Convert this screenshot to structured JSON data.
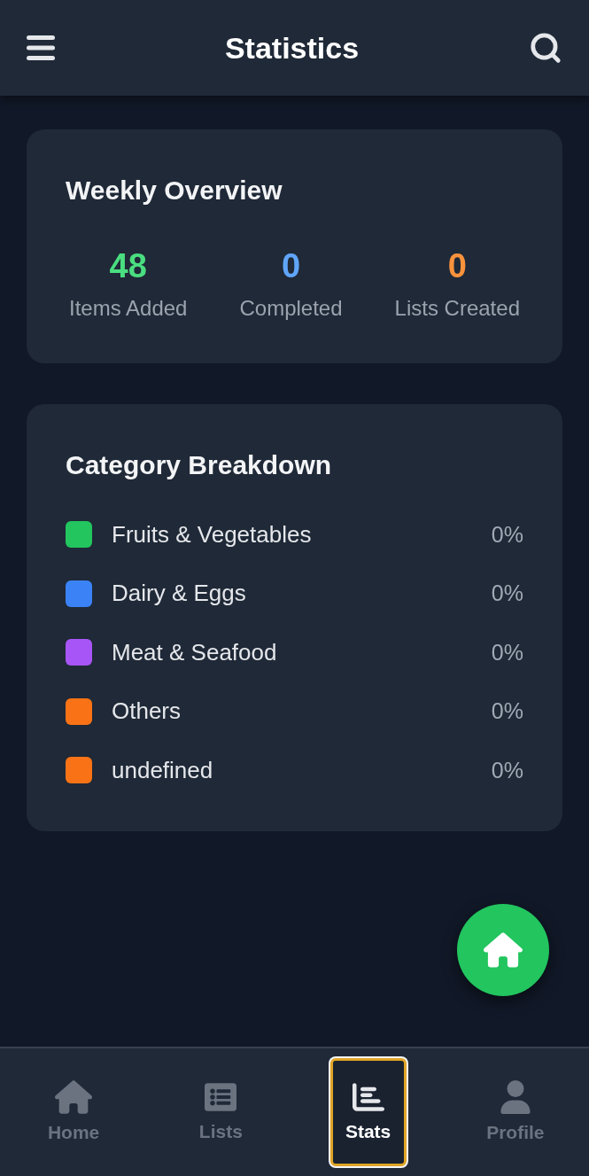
{
  "header": {
    "title": "Statistics"
  },
  "weekly_overview": {
    "title": "Weekly Overview",
    "stats": [
      {
        "value": "48",
        "label": "Items Added",
        "color": "#4ade80"
      },
      {
        "value": "0",
        "label": "Completed",
        "color": "#60a5fa"
      },
      {
        "value": "0",
        "label": "Lists Created",
        "color": "#fb923c"
      }
    ]
  },
  "category_breakdown": {
    "title": "Category Breakdown",
    "categories": [
      {
        "name": "Fruits & Vegetables",
        "percent": "0%",
        "color": "#22c55e"
      },
      {
        "name": "Dairy & Eggs",
        "percent": "0%",
        "color": "#3b82f6"
      },
      {
        "name": "Meat & Seafood",
        "percent": "0%",
        "color": "#a855f7"
      },
      {
        "name": "Others",
        "percent": "0%",
        "color": "#f97316"
      },
      {
        "name": "undefined",
        "percent": "0%",
        "color": "#f97316"
      }
    ]
  },
  "bottom_nav": [
    {
      "label": "Home",
      "selected": false
    },
    {
      "label": "Lists",
      "selected": false
    },
    {
      "label": "Stats",
      "selected": true
    },
    {
      "label": "Profile",
      "selected": false
    }
  ]
}
